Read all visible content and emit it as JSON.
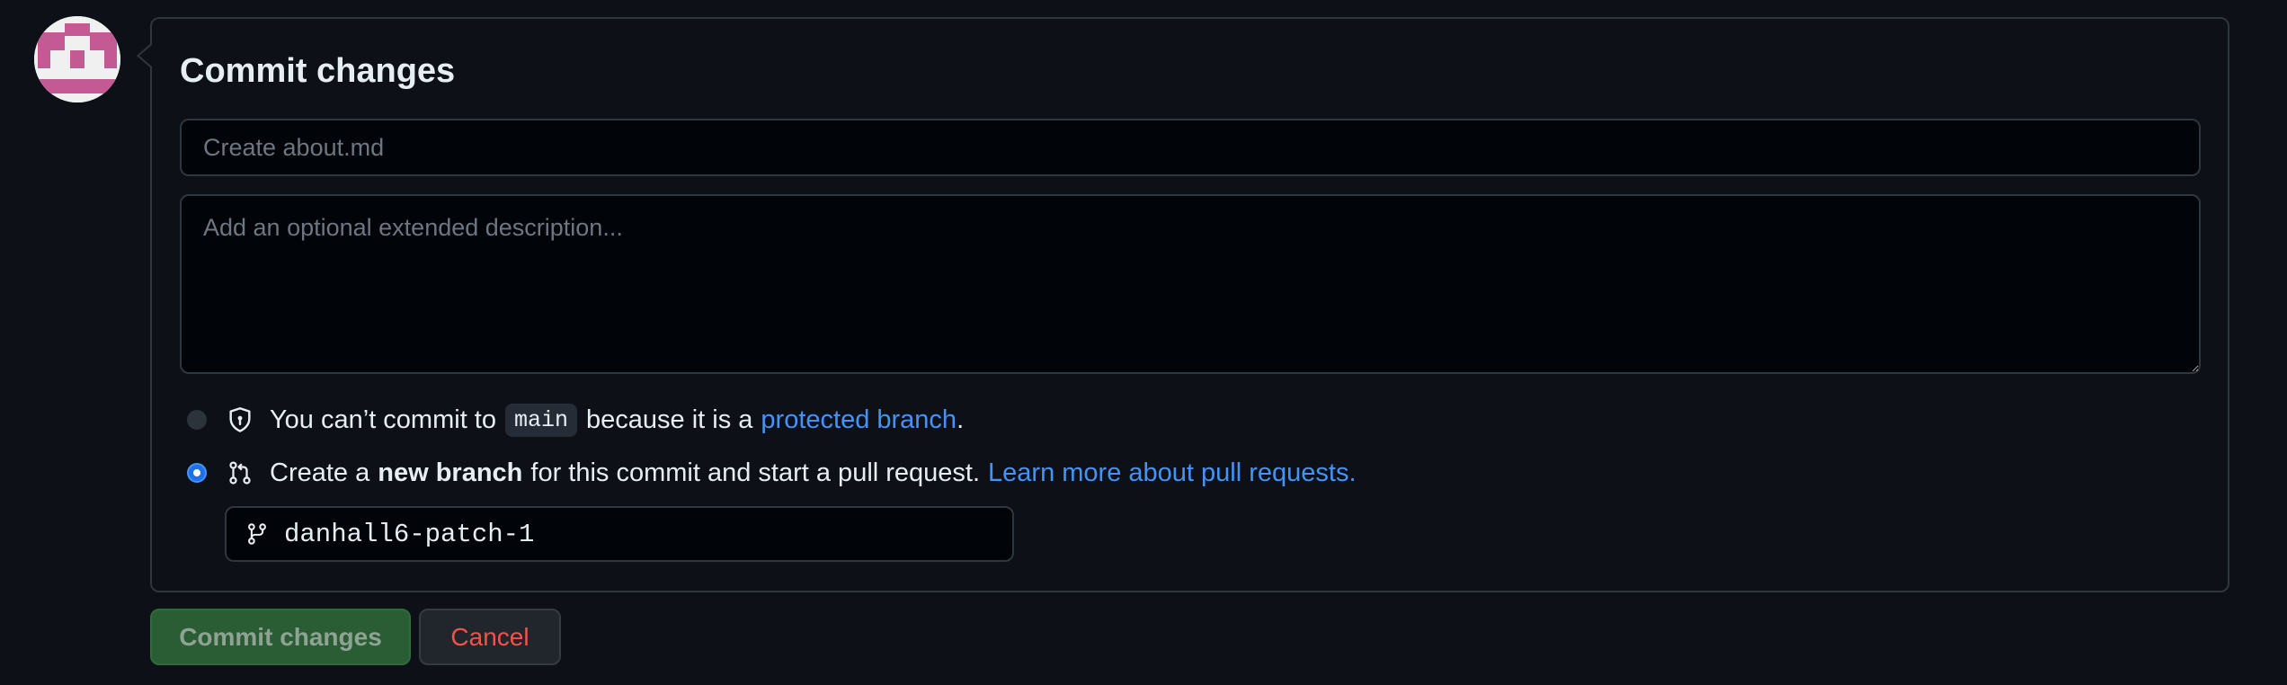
{
  "form": {
    "title": "Commit changes",
    "summary_placeholder": "Create about.md",
    "description_placeholder": "Add an optional extended description..."
  },
  "options": {
    "protected": {
      "text_before": "You can’t commit to",
      "branch_name": "main",
      "text_middle": "because it is a",
      "link_text": "protected branch",
      "text_after": ".",
      "icon": "shield-icon",
      "selected": false,
      "disabled": true
    },
    "new_branch": {
      "text_before": "Create a",
      "bold_text": "new branch",
      "text_after": "for this commit and start a pull request.",
      "link_text": "Learn more about pull requests.",
      "icon": "git-pull-request-icon",
      "selected": true
    }
  },
  "branch_input": {
    "value": "danhall6-patch-1",
    "icon": "git-branch-icon"
  },
  "buttons": {
    "commit_label": "Commit changes",
    "cancel_label": "Cancel"
  },
  "colors": {
    "background": "#0d1117",
    "border": "#30363d",
    "link": "#4493f8",
    "commit_button": "#2a5d33",
    "cancel_text": "#f85149"
  }
}
